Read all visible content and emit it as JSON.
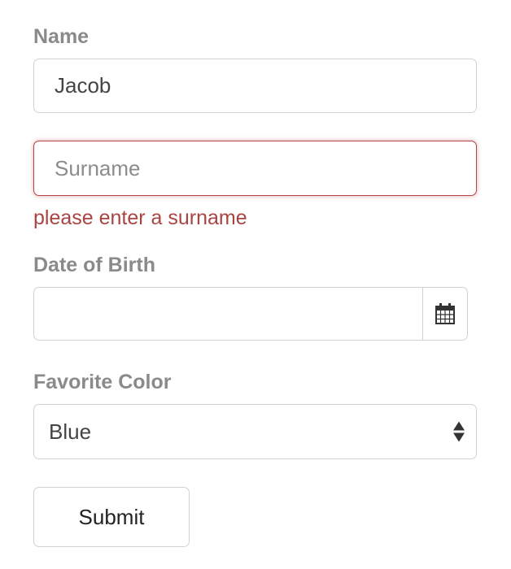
{
  "form": {
    "name_label": "Name",
    "name_value": "Jacob",
    "surname_placeholder": "Surname",
    "surname_value": "",
    "surname_error": "please enter a surname",
    "dob_label": "Date of Birth",
    "dob_value": "",
    "dob_icon": "calendar-icon",
    "color_label": "Favorite Color",
    "color_selected": "Blue",
    "color_icon": "sort-arrows-icon",
    "submit_label": "Submit"
  },
  "colors": {
    "error": "#a94442",
    "error_border": "#b04645",
    "label": "#8a8a8a",
    "border": "#d2d2d2"
  }
}
